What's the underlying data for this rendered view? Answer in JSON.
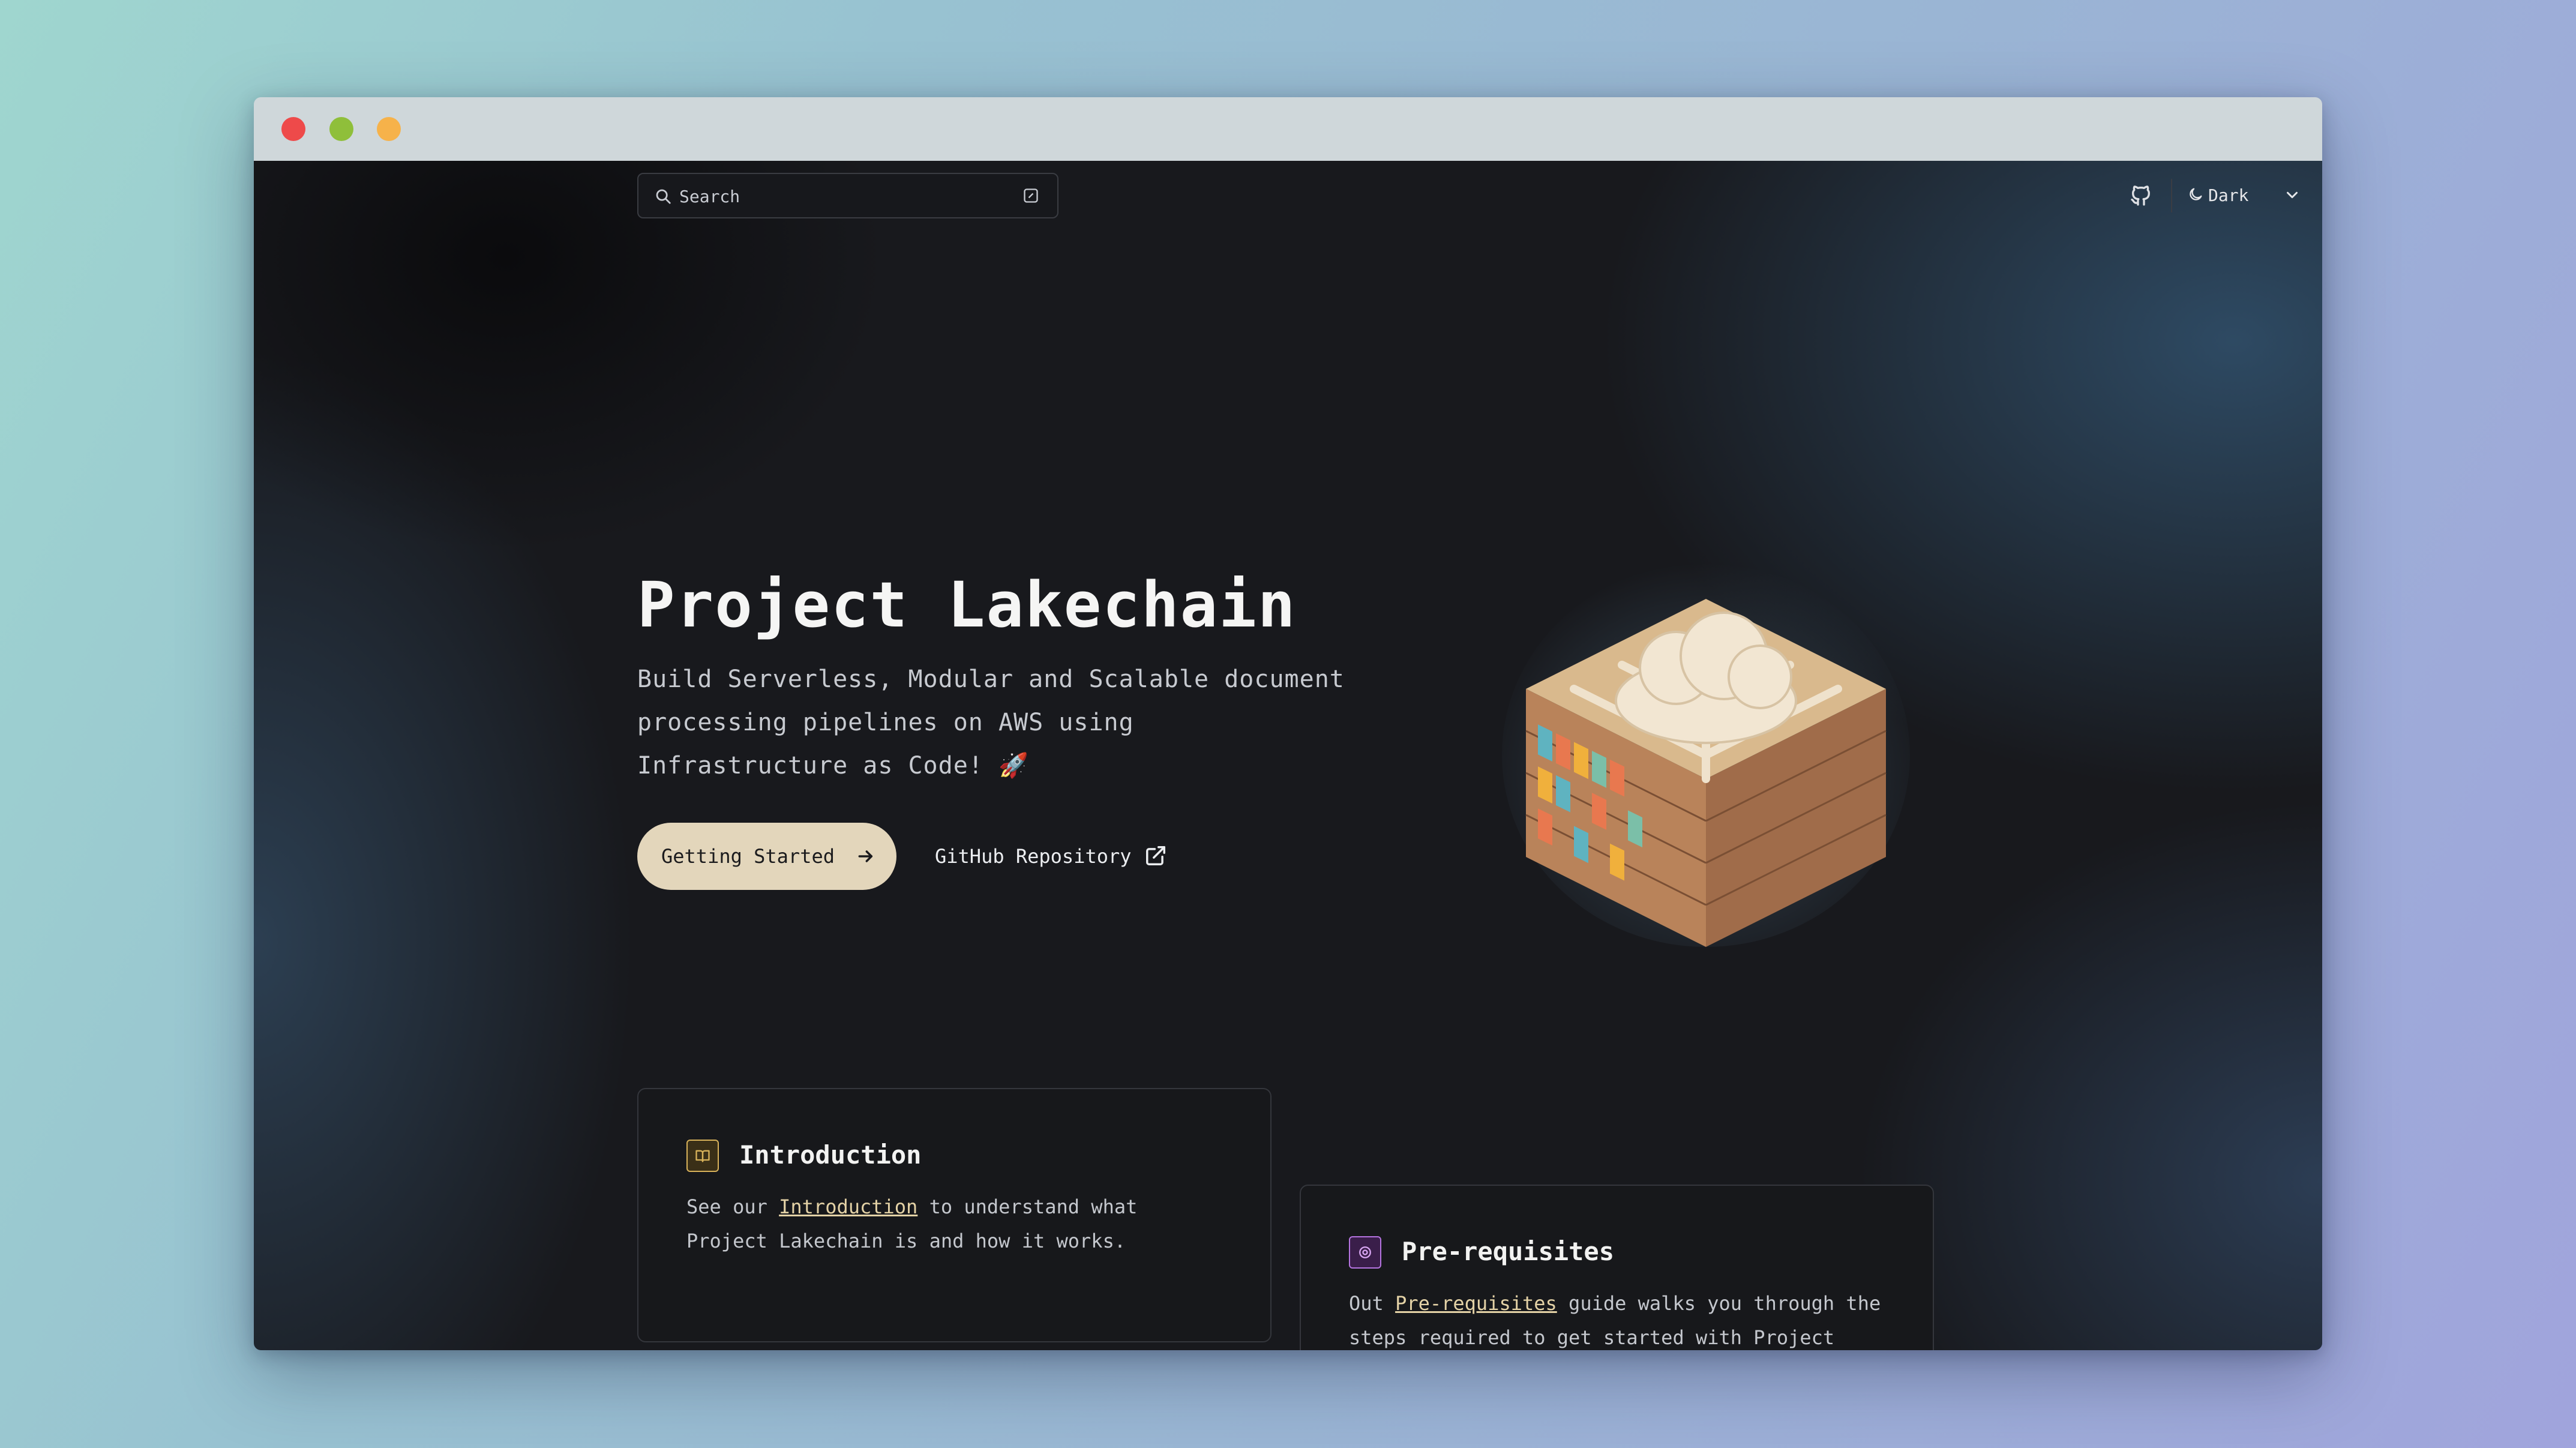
{
  "window": {
    "controls": [
      "close",
      "minimize",
      "maximize"
    ]
  },
  "header": {
    "search_placeholder": "Search",
    "github_icon": "github-icon",
    "theme_label": "Dark"
  },
  "hero": {
    "title": "Project Lakechain",
    "subtitle": "Build Serverless, Modular and Scalable document processing pipelines on AWS using Infrastructure as Code! 🚀",
    "primary_button": "Getting Started",
    "secondary_button": "GitHub Repository",
    "illustration": "isometric cube of bookshelves with cloud"
  },
  "cards": [
    {
      "icon": "book-icon",
      "title": "Introduction",
      "body_prefix": "See our ",
      "link": "Introduction",
      "body_suffix": " to understand what Project Lakechain is and how it works."
    },
    {
      "icon": "gear-icon",
      "title": "Pre-requisites",
      "body_prefix": "Out ",
      "link": "Pre-requisites",
      "body_suffix": " guide walks you through the steps required to get started with Project Lakechain."
    }
  ],
  "colors": {
    "accent": "#e3d6bb",
    "background": "#18191d",
    "link": "#e4d2a6",
    "icon_gold": "#d8b25a",
    "icon_purple": "#b574e0"
  }
}
